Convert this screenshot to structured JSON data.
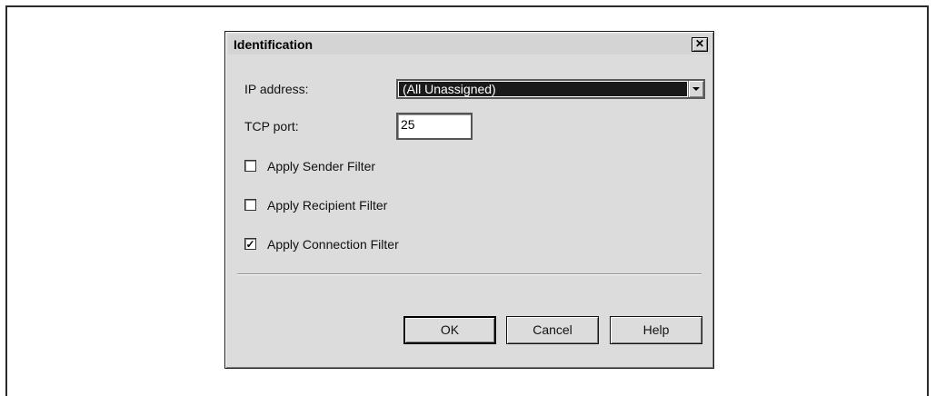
{
  "dialog": {
    "title": "Identification",
    "close_symbol": "✕",
    "ip_label": "IP address:",
    "ip_value": "(All Unassigned)",
    "port_label": "TCP port:",
    "port_value": "25",
    "filters": [
      {
        "label": "Apply Sender Filter",
        "checked": false
      },
      {
        "label": "Apply Recipient Filter",
        "checked": false
      },
      {
        "label": "Apply Connection Filter",
        "checked": true
      }
    ],
    "buttons": {
      "ok": "OK",
      "cancel": "Cancel",
      "help": "Help"
    },
    "check_mark": "✓"
  }
}
